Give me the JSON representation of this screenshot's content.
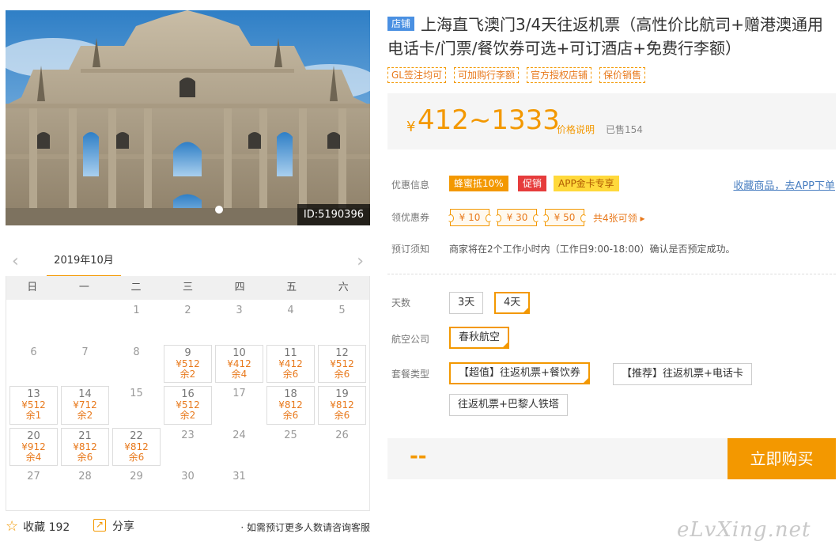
{
  "photo": {
    "id_label": "ID:5190396"
  },
  "calendar": {
    "month": "2019年10月",
    "prev": "‹",
    "next": "›",
    "weekdays": [
      "日",
      "一",
      "二",
      "三",
      "四",
      "五",
      "六"
    ],
    "days": [
      {
        "d": "",
        "p": "",
        "l": ""
      },
      {
        "d": "",
        "p": "",
        "l": ""
      },
      {
        "d": "1",
        "p": "",
        "l": ""
      },
      {
        "d": "2",
        "p": "",
        "l": ""
      },
      {
        "d": "3",
        "p": "",
        "l": ""
      },
      {
        "d": "4",
        "p": "",
        "l": ""
      },
      {
        "d": "5",
        "p": "",
        "l": ""
      },
      {
        "d": "6",
        "p": "",
        "l": ""
      },
      {
        "d": "7",
        "p": "",
        "l": ""
      },
      {
        "d": "8",
        "p": "",
        "l": ""
      },
      {
        "d": "9",
        "p": "¥512",
        "l": "余2"
      },
      {
        "d": "10",
        "p": "¥412",
        "l": "余4"
      },
      {
        "d": "11",
        "p": "¥412",
        "l": "余6"
      },
      {
        "d": "12",
        "p": "¥512",
        "l": "余6"
      },
      {
        "d": "13",
        "p": "¥512",
        "l": "余1"
      },
      {
        "d": "14",
        "p": "¥712",
        "l": "余2"
      },
      {
        "d": "15",
        "p": "",
        "l": ""
      },
      {
        "d": "16",
        "p": "¥512",
        "l": "余2"
      },
      {
        "d": "17",
        "p": "",
        "l": ""
      },
      {
        "d": "18",
        "p": "¥812",
        "l": "余6"
      },
      {
        "d": "19",
        "p": "¥812",
        "l": "余6"
      },
      {
        "d": "20",
        "p": "¥912",
        "l": "余4"
      },
      {
        "d": "21",
        "p": "¥812",
        "l": "余6"
      },
      {
        "d": "22",
        "p": "¥812",
        "l": "余6"
      },
      {
        "d": "23",
        "p": "",
        "l": ""
      },
      {
        "d": "24",
        "p": "",
        "l": ""
      },
      {
        "d": "25",
        "p": "",
        "l": ""
      },
      {
        "d": "26",
        "p": "",
        "l": ""
      },
      {
        "d": "27",
        "p": "",
        "l": ""
      },
      {
        "d": "28",
        "p": "",
        "l": ""
      },
      {
        "d": "29",
        "p": "",
        "l": ""
      },
      {
        "d": "30",
        "p": "",
        "l": ""
      },
      {
        "d": "31",
        "p": "",
        "l": ""
      }
    ]
  },
  "footer": {
    "fav_icon": "☆",
    "fav_label": "收藏",
    "fav_count": "192",
    "share_label": "分享",
    "cs_note": "· 如需预订更多人数请咨询客服"
  },
  "product": {
    "shop_tag": "店铺",
    "title": "上海直飞澳门3/4天往返机票（高性价比航司+赠港澳通用电话卡/门票/餐饮券可选+可订酒店+免费行李额）",
    "tags": [
      "GL签注均可",
      "可加购行李额",
      "官方授权店铺",
      "保价销售"
    ],
    "price_currency": "¥",
    "price_range": "412~1333",
    "price_note": "价格说明",
    "sold": "已售154"
  },
  "promos": {
    "label": "优惠信息",
    "items": [
      "蜂蜜抵10%",
      "促销",
      "APP金卡专享"
    ],
    "app_link": "收藏商品，去APP下单"
  },
  "coupons": {
    "label": "领优惠券",
    "items": [
      "¥ 10",
      "¥ 30",
      "¥ 50"
    ],
    "more": "共4张可领 ▸"
  },
  "booking": {
    "label": "预订须知",
    "note": "商家将在2个工作小时内（工作日9:00-18:00）确认是否预定成功。"
  },
  "options": {
    "days_label": "天数",
    "days": [
      "3天",
      "4天"
    ],
    "airline_label": "航空公司",
    "airline": "春秋航空",
    "package_label": "套餐类型",
    "packages": [
      "【超值】往返机票+餐饮券",
      "【推荐】往返机票+电话卡",
      "往返机票+巴黎人铁塔"
    ]
  },
  "buy": {
    "price_placeholder": "--",
    "button": "立即购买"
  },
  "watermark": "eLvXing.net",
  "colors": {
    "accent": "#f39800",
    "price": "#f39800",
    "link": "#4a7fc1",
    "shop_tag": "#4a90e2"
  }
}
